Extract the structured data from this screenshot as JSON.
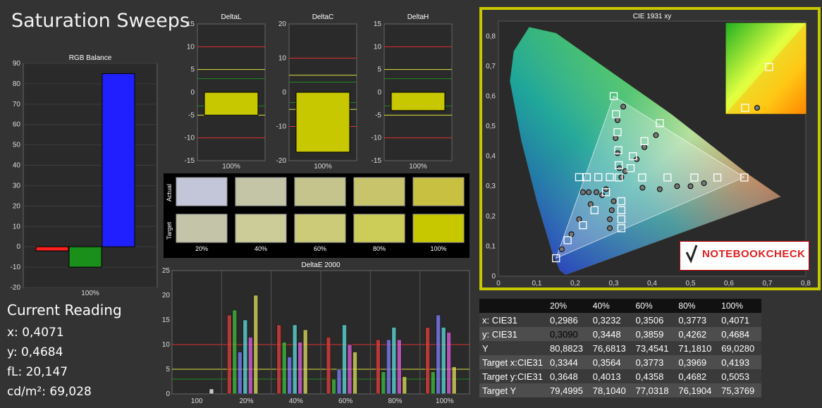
{
  "title": "Saturation Sweeps",
  "current_reading": {
    "title": "Current Reading",
    "x": "x: 0,4071",
    "y": "y: 0,4684",
    "fl": "fL: 20,147",
    "cd": "cd/m²: 69,028"
  },
  "logo": "NOTEBOOKCHECK",
  "colors": {
    "red": "#ff2020",
    "green": "#1a8f1a",
    "blue": "#2020ff",
    "yellow": "#d6d600",
    "frame": "#c8c800"
  },
  "chart_data": [
    {
      "type": "bar",
      "title": "RGB Balance",
      "categories": [
        "Red",
        "Green",
        "Blue"
      ],
      "values": [
        -2,
        -10,
        85
      ],
      "ylim": [
        -20,
        90
      ],
      "yticks": [
        "90",
        "80",
        "70",
        "60",
        "50",
        "40",
        "30",
        "20",
        "10",
        "0",
        "-10",
        "-20"
      ],
      "xlabel": "100%"
    },
    {
      "type": "bar",
      "title": "DeltaL",
      "values": [
        -5
      ],
      "ylim": [
        -15,
        15
      ],
      "yticks": [
        "15",
        "10",
        "5",
        "0",
        "-5",
        "-10",
        "-15"
      ],
      "xlabel": "100%"
    },
    {
      "type": "bar",
      "title": "DeltaC",
      "values": [
        -17.5
      ],
      "ylim": [
        -20,
        20
      ],
      "yticks": [
        "20",
        "10",
        "0",
        "-10",
        "-20"
      ],
      "xlabel": "100%"
    },
    {
      "type": "bar",
      "title": "DeltaH",
      "values": [
        -4
      ],
      "ylim": [
        -15,
        15
      ],
      "yticks": [
        "15",
        "10",
        "5",
        "0",
        "-5",
        "-10",
        "-15"
      ],
      "xlabel": "100%"
    },
    {
      "type": "table",
      "rows": [
        "Actual",
        "Target"
      ],
      "columns": [
        "20%",
        "40%",
        "60%",
        "80%",
        "100%"
      ],
      "actual_colors": [
        "#c2c6d8",
        "#c4c4a6",
        "#c4c48c",
        "#c8c46c",
        "#c8c040"
      ],
      "target_colors": [
        "#c4c4a8",
        "#cccc98",
        "#cccc78",
        "#cccc58",
        "#c8c800"
      ]
    },
    {
      "type": "bar",
      "title": "DeltaE 2000",
      "categories": [
        "100",
        "20%",
        "40%",
        "60%",
        "80%",
        "100%"
      ],
      "series_colors": [
        "#e24040",
        "#40c040",
        "#8080ff",
        "#60e0e0",
        "#e060e0",
        "#e0e060",
        "#ffffff"
      ],
      "values": [
        [
          0,
          0,
          0,
          0,
          0,
          0,
          1
        ],
        [
          16,
          17,
          8.5,
          15,
          11.5,
          20,
          0
        ],
        [
          14,
          10.5,
          7.5,
          14,
          10.5,
          13,
          0
        ],
        [
          11.5,
          3,
          5,
          14,
          10,
          8.5,
          0
        ],
        [
          11,
          4.5,
          11,
          13.5,
          11,
          3.5,
          0
        ],
        [
          13.5,
          4.5,
          16,
          13.5,
          12.5,
          5.5,
          0
        ]
      ],
      "ylim": [
        0,
        25
      ],
      "yticks": [
        "25",
        "20",
        "15",
        "10",
        "5",
        "0"
      ]
    },
    {
      "type": "scatter",
      "title": "CIE 1931 xy",
      "xlim": [
        0,
        0.8
      ],
      "ylim": [
        0,
        0.85
      ],
      "xticks": [
        "0",
        "0,1",
        "0,2",
        "0,3",
        "0,4",
        "0,5",
        "0,6",
        "0,7",
        "0,8"
      ],
      "yticks": [
        "0,8",
        "0,7",
        "0,6",
        "0,5",
        "0,4",
        "0,3",
        "0,2",
        "0,1",
        "0"
      ],
      "gamut": [
        [
          0.64,
          0.33
        ],
        [
          0.3,
          0.6
        ],
        [
          0.15,
          0.06
        ]
      ],
      "targets": [
        [
          0.313,
          0.329
        ],
        [
          0.374,
          0.329
        ],
        [
          0.44,
          0.329
        ],
        [
          0.51,
          0.329
        ],
        [
          0.57,
          0.329
        ],
        [
          0.64,
          0.329
        ],
        [
          0.3,
          0.6
        ],
        [
          0.306,
          0.54
        ],
        [
          0.31,
          0.48
        ],
        [
          0.312,
          0.42
        ],
        [
          0.313,
          0.37
        ],
        [
          0.15,
          0.06
        ],
        [
          0.18,
          0.12
        ],
        [
          0.22,
          0.17
        ],
        [
          0.25,
          0.22
        ],
        [
          0.28,
          0.28
        ],
        [
          0.21,
          0.33
        ],
        [
          0.23,
          0.33
        ],
        [
          0.26,
          0.33
        ],
        [
          0.29,
          0.33
        ],
        [
          0.32,
          0.19
        ],
        [
          0.32,
          0.22
        ],
        [
          0.32,
          0.25
        ],
        [
          0.32,
          0.16
        ],
        [
          0.42,
          0.51
        ],
        [
          0.38,
          0.45
        ],
        [
          0.35,
          0.4
        ],
        [
          0.344,
          0.36
        ]
      ],
      "actual": [
        [
          0.32,
          0.33
        ],
        [
          0.375,
          0.295
        ],
        [
          0.42,
          0.29
        ],
        [
          0.465,
          0.3
        ],
        [
          0.5,
          0.3
        ],
        [
          0.535,
          0.31
        ],
        [
          0.325,
          0.565
        ],
        [
          0.31,
          0.52
        ],
        [
          0.305,
          0.46
        ],
        [
          0.31,
          0.41
        ],
        [
          0.315,
          0.36
        ],
        [
          0.165,
          0.09
        ],
        [
          0.19,
          0.14
        ],
        [
          0.21,
          0.19
        ],
        [
          0.24,
          0.24
        ],
        [
          0.27,
          0.27
        ],
        [
          0.22,
          0.28
        ],
        [
          0.235,
          0.28
        ],
        [
          0.255,
          0.28
        ],
        [
          0.28,
          0.29
        ],
        [
          0.29,
          0.16
        ],
        [
          0.29,
          0.19
        ],
        [
          0.295,
          0.22
        ],
        [
          0.3,
          0.25
        ],
        [
          0.41,
          0.47
        ],
        [
          0.38,
          0.43
        ],
        [
          0.36,
          0.39
        ],
        [
          0.33,
          0.35
        ]
      ]
    }
  ],
  "table": {
    "headers": [
      "",
      "20%",
      "40%",
      "60%",
      "80%",
      "100%"
    ],
    "rows": [
      [
        "x: CIE31",
        "0,2986",
        "0,3232",
        "0,3506",
        "0,3773",
        "0,4071"
      ],
      [
        "y: CIE31",
        "0,3090",
        "0,3448",
        "0,3859",
        "0,4262",
        "0,4684"
      ],
      [
        "Y",
        "80,8823",
        "76,6813",
        "73,4541",
        "71,1810",
        "69,0280"
      ],
      [
        "Target x:CIE31",
        "0,3344",
        "0,3564",
        "0,3773",
        "0,3969",
        "0,4193"
      ],
      [
        "Target y:CIE31",
        "0,3648",
        "0,4013",
        "0,4358",
        "0,4682",
        "0,5053"
      ],
      [
        "Target Y",
        "79,4995",
        "78,1040",
        "77,0318",
        "76,1904",
        "75,3769"
      ]
    ]
  }
}
